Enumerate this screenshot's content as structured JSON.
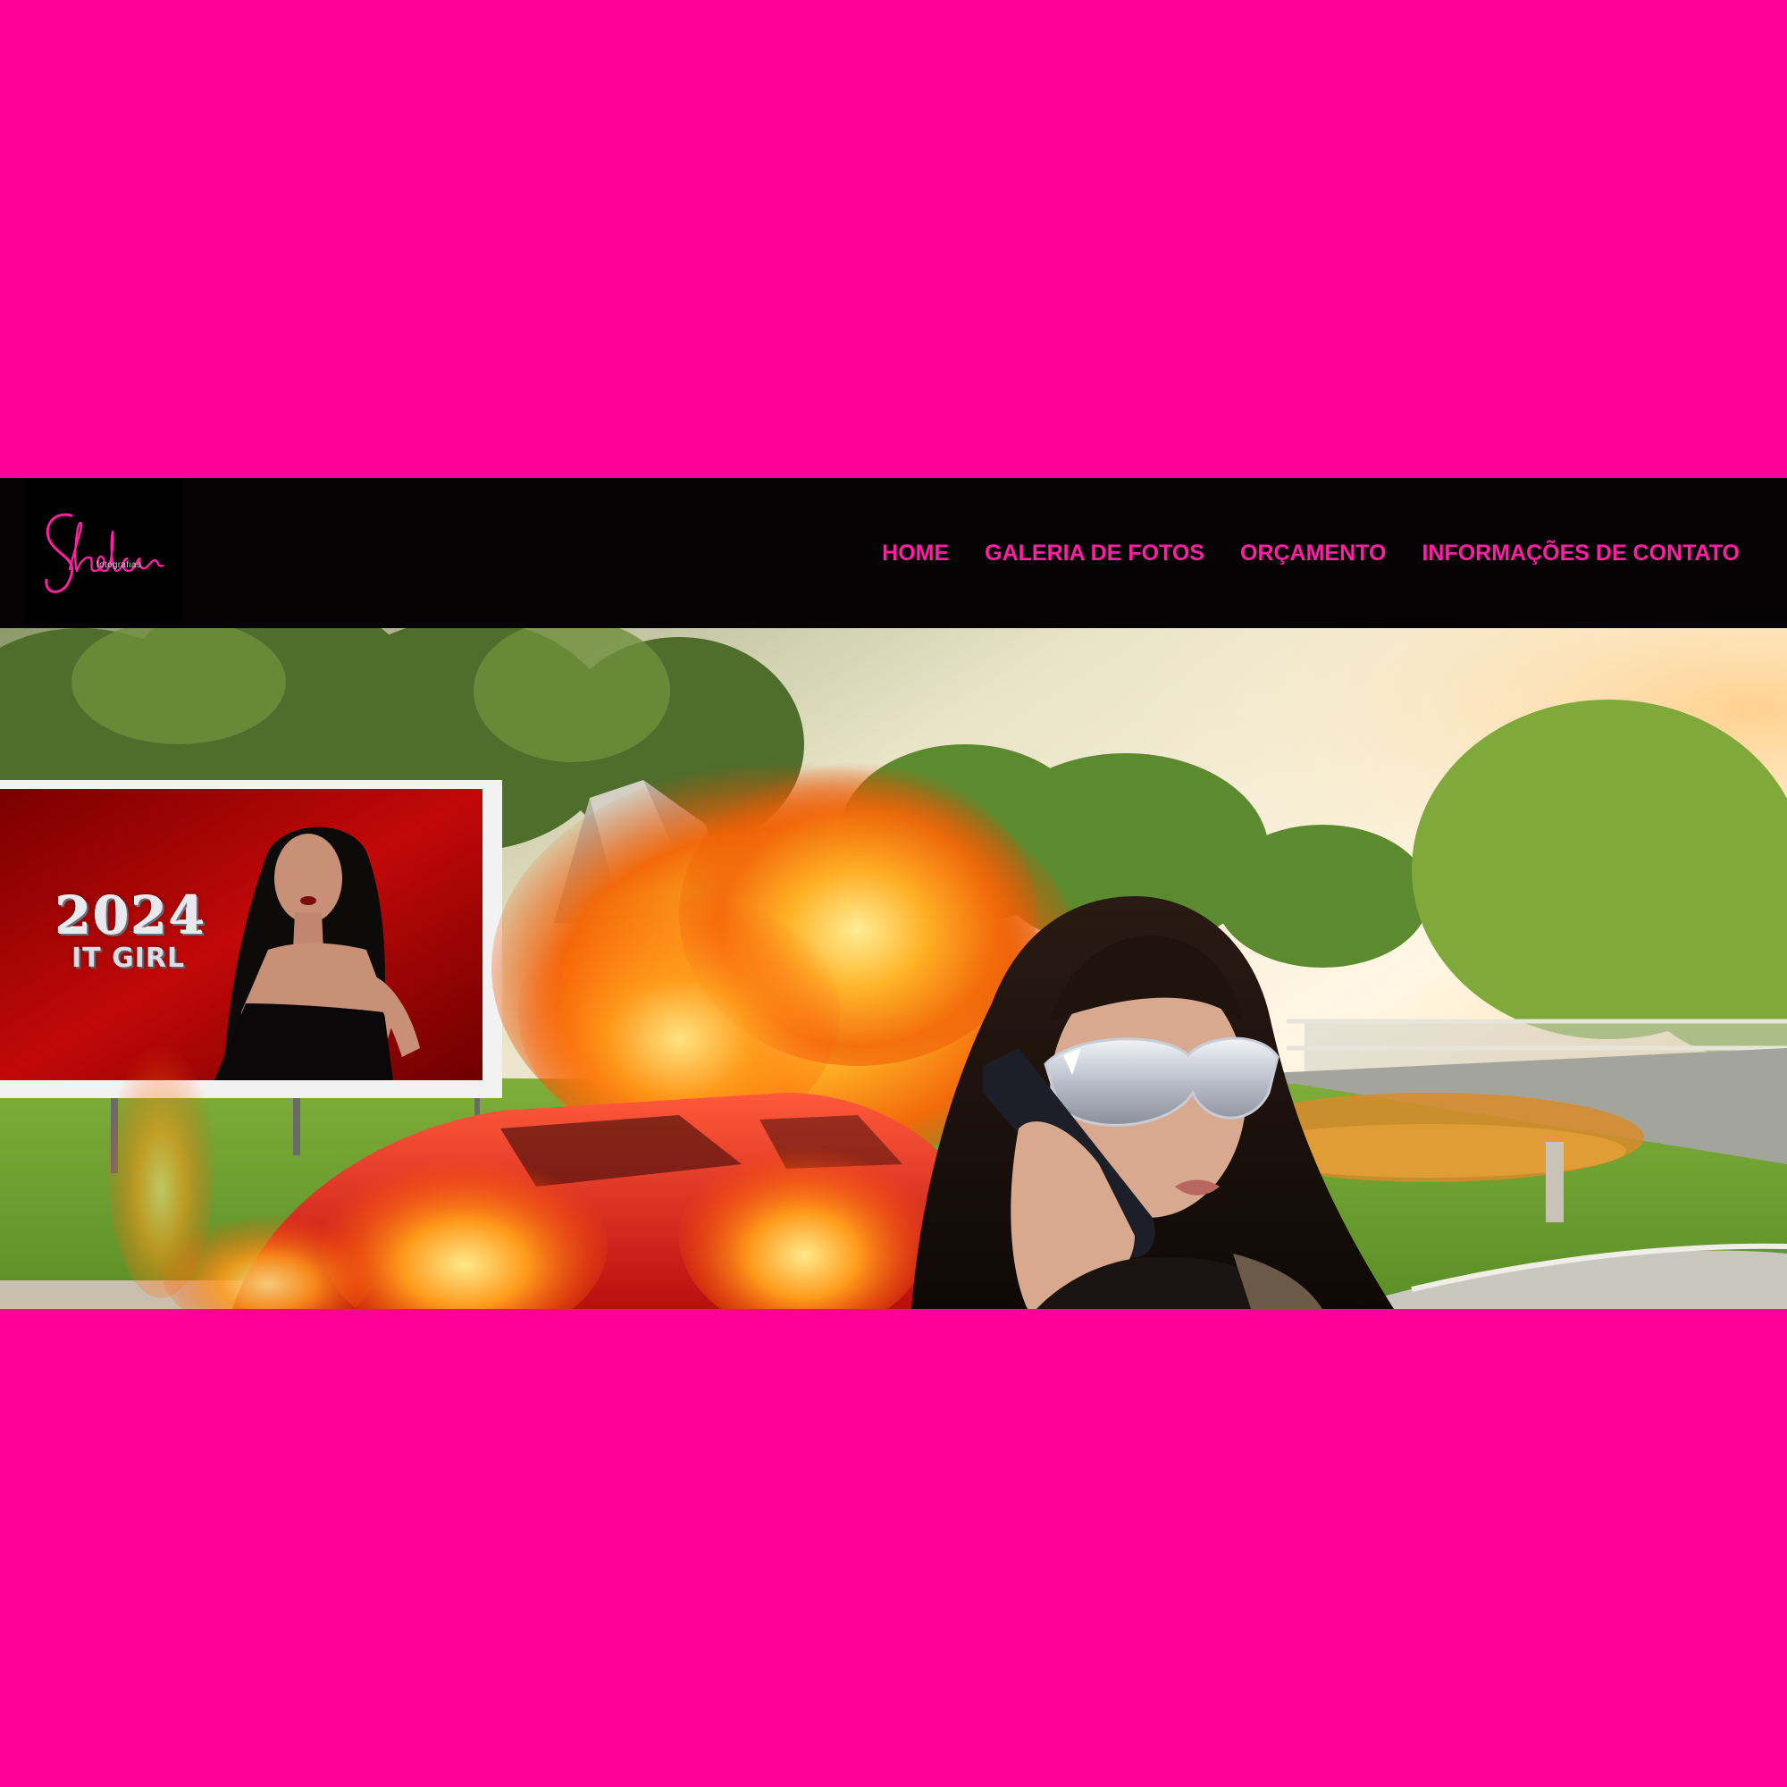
{
  "brand": {
    "logo_script": "Shelar",
    "logo_sub": "fotografias"
  },
  "nav": {
    "items": [
      {
        "label": "HOME"
      },
      {
        "label": "GALERIA DE FOTOS"
      },
      {
        "label": "ORÇAMENTO"
      },
      {
        "label": "INFORMAÇÕES DE CONTATO"
      }
    ]
  },
  "hero": {
    "billboard_year": "2024",
    "billboard_tagline": "IT GIRL"
  },
  "colors": {
    "page_background": "#ff0198",
    "navbar_background": "#060304",
    "nav_link": "#ff1fa3"
  }
}
